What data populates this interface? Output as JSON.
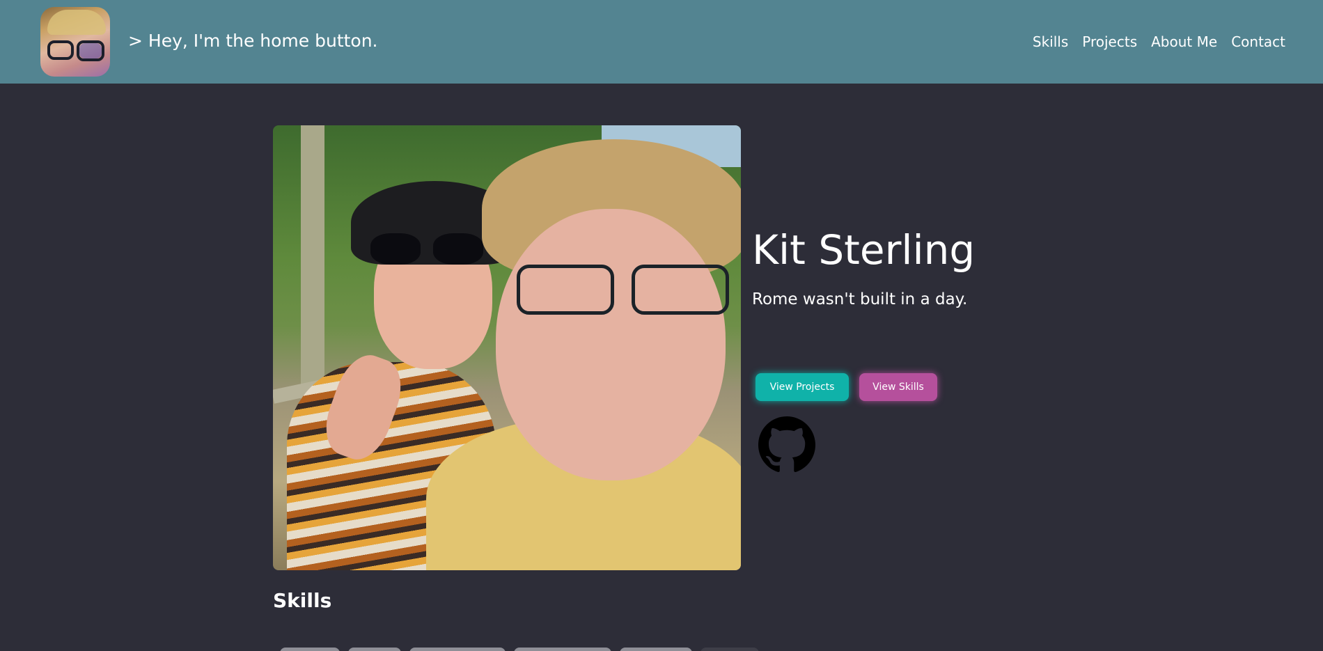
{
  "navbar": {
    "home_label": "> Hey, I'm the home button.",
    "links": [
      "Skills",
      "Projects",
      "About Me",
      "Contact"
    ],
    "background_color": "#538491"
  },
  "hero": {
    "name": "Kit Sterling",
    "tagline": "Rome wasn't built in a day.",
    "buttons": {
      "projects": "View Projects",
      "skills": "View Skills"
    },
    "button_colors": {
      "projects": "#10b2a9",
      "skills": "#b5509c"
    },
    "social_icon": "github-icon"
  },
  "skills": {
    "heading": "Skills"
  }
}
